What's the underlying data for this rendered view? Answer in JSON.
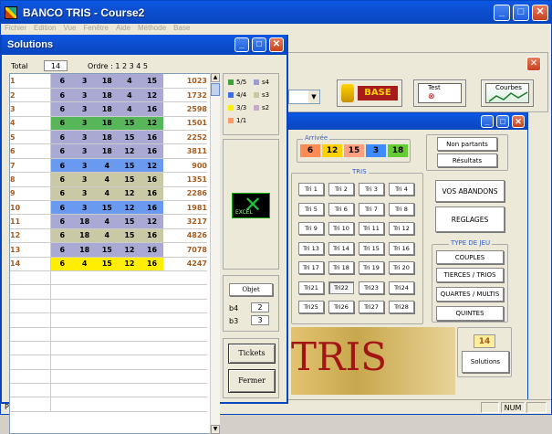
{
  "app": {
    "title": "BANCO TRIS - Course2"
  },
  "menu": [
    "Fichier",
    "Edition",
    "Vue",
    "Fenêtre",
    "Aide",
    "Méthode",
    "Base"
  ],
  "status": {
    "text": "Prêt",
    "num": "NUM"
  },
  "toolbar": {
    "base_label": "BASE",
    "test_label": "Test",
    "courbes_label": "Courbes"
  },
  "inner": {
    "arrivee_label": "Arrivée",
    "arrivee": [
      {
        "value": "6",
        "color": "#ff8c55"
      },
      {
        "value": "12",
        "color": "#ffd200"
      },
      {
        "value": "15",
        "color": "#ffa080"
      },
      {
        "value": "3",
        "color": "#3d8bff"
      },
      {
        "value": "18",
        "color": "#66cc33"
      }
    ],
    "non_partants": "Non partants",
    "resultats": "Résultats",
    "tris_label": "TRIS",
    "tris": [
      "Tri 1",
      "Tri 2",
      "Tri 3",
      "Tri 4",
      "Tri 5",
      "Tri 6",
      "Tri 7",
      "Tri 8",
      "Tri 9",
      "Tri 10",
      "Tri 11",
      "Tri 12",
      "Tri 13",
      "Tri 14",
      "Tri 15",
      "Tri 16",
      "Tri 17",
      "Tri 18",
      "Tri 19",
      "Tri 20",
      "Tri21",
      "Tri22",
      "Tri23",
      "Tri24",
      "Tri25",
      "Tri26",
      "Tri27",
      "Tri28"
    ],
    "vos_abandons": "VOS ABANDONS",
    "reglages": "REGLAGES",
    "type_jeu_label": "TYPE DE JEU",
    "couples": "COUPLES",
    "tierces_trios": "TIERCES / TRIOS",
    "quartes_multis": "QUARTES / MULTIS",
    "quintes": "QUINTES",
    "count": "14",
    "solutions_btn": "Solutions",
    "banner": "TRIS"
  },
  "solutions": {
    "title": "Solutions",
    "total_label": "Total",
    "total_value": "14",
    "ordre_label": "Ordre : 1 2 3 4 5",
    "rows": [
      {
        "n": "1",
        "nums": [
          "6",
          "3",
          "18",
          "4",
          "15"
        ],
        "total": "1023",
        "bg": "#a9a9d4"
      },
      {
        "n": "2",
        "nums": [
          "6",
          "3",
          "18",
          "4",
          "12"
        ],
        "total": "1732",
        "bg": "#a9a9d4"
      },
      {
        "n": "3",
        "nums": [
          "6",
          "3",
          "18",
          "4",
          "16"
        ],
        "total": "2598",
        "bg": "#a9a9d4"
      },
      {
        "n": "4",
        "nums": [
          "6",
          "3",
          "18",
          "15",
          "12"
        ],
        "total": "1501",
        "bg": "#58b65a"
      },
      {
        "n": "5",
        "nums": [
          "6",
          "3",
          "18",
          "15",
          "16"
        ],
        "total": "2252",
        "bg": "#a9a9d4"
      },
      {
        "n": "6",
        "nums": [
          "6",
          "3",
          "18",
          "12",
          "16"
        ],
        "total": "3811",
        "bg": "#a9a9d4"
      },
      {
        "n": "7",
        "nums": [
          "6",
          "3",
          "4",
          "15",
          "12"
        ],
        "total": "900",
        "bg": "#6a9aef"
      },
      {
        "n": "8",
        "nums": [
          "6",
          "3",
          "4",
          "15",
          "16"
        ],
        "total": "1351",
        "bg": "#c9c9a6"
      },
      {
        "n": "9",
        "nums": [
          "6",
          "3",
          "4",
          "12",
          "16"
        ],
        "total": "2286",
        "bg": "#c9c9a6"
      },
      {
        "n": "10",
        "nums": [
          "6",
          "3",
          "15",
          "12",
          "16"
        ],
        "total": "1981",
        "bg": "#6a9aef"
      },
      {
        "n": "11",
        "nums": [
          "6",
          "18",
          "4",
          "15",
          "12"
        ],
        "total": "3217",
        "bg": "#a9a9d4"
      },
      {
        "n": "12",
        "nums": [
          "6",
          "18",
          "4",
          "15",
          "16"
        ],
        "total": "4826",
        "bg": "#c9c9a6"
      },
      {
        "n": "13",
        "nums": [
          "6",
          "18",
          "15",
          "12",
          "16"
        ],
        "total": "7078",
        "bg": "#a9a9d4"
      },
      {
        "n": "14",
        "nums": [
          "6",
          "4",
          "15",
          "12",
          "16"
        ],
        "total": "4247",
        "bg": "#ffee00"
      }
    ],
    "legend": [
      {
        "label": "5/5",
        "color": "#3aa33a"
      },
      {
        "label": "s4",
        "color": "#9c9cd0"
      },
      {
        "label": "4/4",
        "color": "#3d6ee8"
      },
      {
        "label": "s3",
        "color": "#c8c8a0"
      },
      {
        "label": "3/3",
        "color": "#ffee00"
      },
      {
        "label": "s2",
        "color": "#c8a8c8"
      },
      {
        "label": "1/1",
        "color": "#ff9966"
      }
    ],
    "excel_label": "EXCEL",
    "objet_label": "Objet",
    "b4_label": "b4",
    "b4_value": "2",
    "b3_label": "b3",
    "b3_value": "3",
    "tickets": "Tickets",
    "fermer": "Fermer"
  }
}
